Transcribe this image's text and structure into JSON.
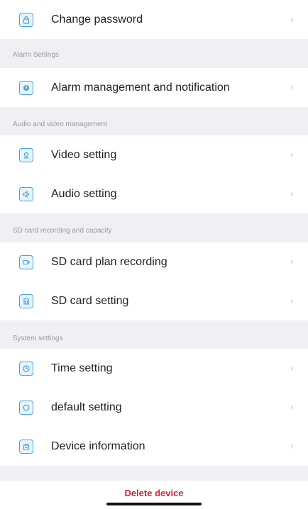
{
  "rows": {
    "change_password": "Change password",
    "alarm_management": "Alarm management and notification",
    "video_setting": "Video setting",
    "audio_setting": "Audio setting",
    "sd_plan_recording": "SD card plan recording",
    "sd_card_setting": "SD card setting",
    "time_setting": "Time setting",
    "default_setting": "default setting",
    "device_information": "Device information"
  },
  "sections": {
    "alarm": "Alarm Settings",
    "audio_video": "Audio and video management",
    "sd_card": "SD card recording and capacity",
    "system": "System settings"
  },
  "chevron": "›",
  "delete_label": "Delete device",
  "colors": {
    "accent_icon": "#43a4dc",
    "delete_text": "#d0263a",
    "background": "#efeff4"
  }
}
